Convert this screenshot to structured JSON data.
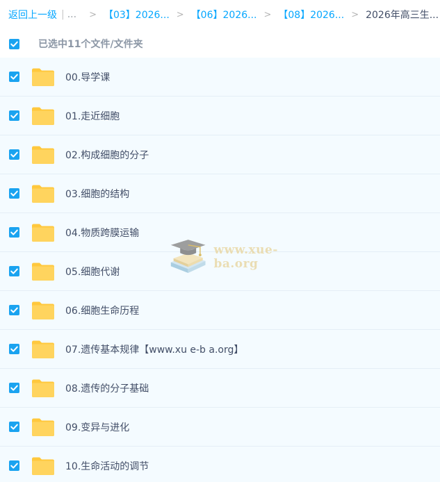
{
  "breadcrumb": {
    "back_label": "返回上一级",
    "pipe": "|",
    "ellipsis": "...",
    "separator": ">",
    "crumbs": [
      "【03】2026...",
      "【06】2026...",
      "【08】2026..."
    ],
    "current": "2026年高三生..."
  },
  "selection": {
    "checked": true,
    "count_text": "已选中11个文件/文件夹"
  },
  "files": [
    {
      "name": "00.导学课",
      "type": "folder",
      "checked": true
    },
    {
      "name": "01.走近细胞",
      "type": "folder",
      "checked": true
    },
    {
      "name": "02.构成细胞的分子",
      "type": "folder",
      "checked": true
    },
    {
      "name": "03.细胞的结构",
      "type": "folder",
      "checked": true
    },
    {
      "name": "04.物质跨膜运输",
      "type": "folder",
      "checked": true
    },
    {
      "name": "05.细胞代谢",
      "type": "folder",
      "checked": true
    },
    {
      "name": "06.细胞生命历程",
      "type": "folder",
      "checked": true
    },
    {
      "name": "07.遗传基本规律【www.xu e-b a.org】",
      "type": "folder",
      "checked": true
    },
    {
      "name": "08.遗传的分子基础",
      "type": "folder",
      "checked": true
    },
    {
      "name": "09.变异与进化",
      "type": "folder",
      "checked": true
    },
    {
      "name": "10.生命活动的调节",
      "type": "folder",
      "checked": true
    }
  ],
  "watermark": {
    "text": "www.xue-ba.org",
    "icon": "graduation-cap-books-icon"
  },
  "colors": {
    "accent": "#06a7ff",
    "checkbox": "#1aa3f0",
    "row_bg": "#f4fbff",
    "folder": "#ffd45e",
    "text": "#424e67"
  }
}
